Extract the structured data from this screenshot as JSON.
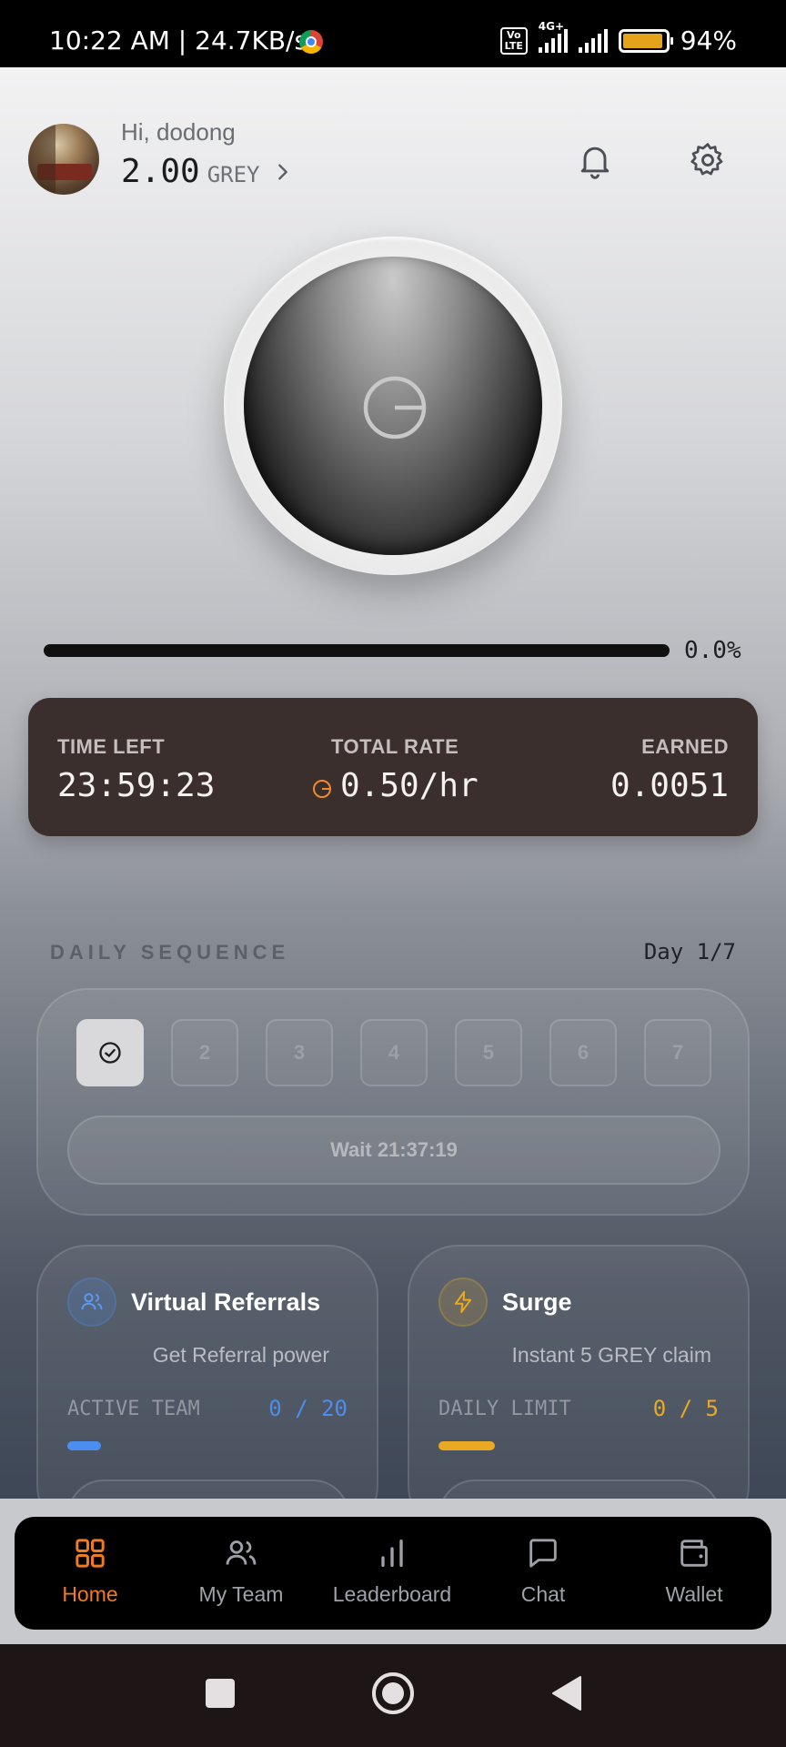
{
  "status_bar": {
    "time": "10:22 AM",
    "speed": "24.7KB/s",
    "volte": "Vo LTE",
    "network": "4G+",
    "battery": "94%",
    "battery_level": 0.94
  },
  "header": {
    "greeting": "Hi, dodong",
    "balance": "2.00",
    "currency": "GREY"
  },
  "mining": {
    "progress_text": "0.0%",
    "progress": 0.0
  },
  "stats": {
    "time_left_label": "TIME LEFT",
    "time_left": "23:59:23",
    "rate_label": "TOTAL RATE",
    "rate": "0.50/hr",
    "earned_label": "EARNED",
    "earned": "0.0051"
  },
  "daily_sequence": {
    "title": "DAILY SEQUENCE",
    "day_status": "Day 1/7",
    "days": [
      "1",
      "2",
      "3",
      "4",
      "5",
      "6",
      "7"
    ],
    "completed_days": 1,
    "wait_label": "Wait 21:37:19"
  },
  "cards": {
    "referrals": {
      "title": "Virtual Referrals",
      "subtitle": "Get Referral power",
      "metric_label": "ACTIVE TEAM",
      "metric_value": "0 / 20",
      "fill": 0.12,
      "accent": "#4a8ef0"
    },
    "surge": {
      "title": "Surge",
      "subtitle": "Instant 5 GREY claim",
      "metric_label": "DAILY LIMIT",
      "metric_value": "0 / 5",
      "fill": 0.2,
      "accent": "#e9a923"
    }
  },
  "nav": {
    "items": [
      {
        "label": "Home",
        "icon": "grid-icon",
        "active": true
      },
      {
        "label": "My Team",
        "icon": "users-icon",
        "active": false
      },
      {
        "label": "Leaderboard",
        "icon": "bar-chart-icon",
        "active": false
      },
      {
        "label": "Chat",
        "icon": "chat-icon",
        "active": false
      },
      {
        "label": "Wallet",
        "icon": "wallet-icon",
        "active": false
      }
    ],
    "active_color": "#f07a22"
  }
}
